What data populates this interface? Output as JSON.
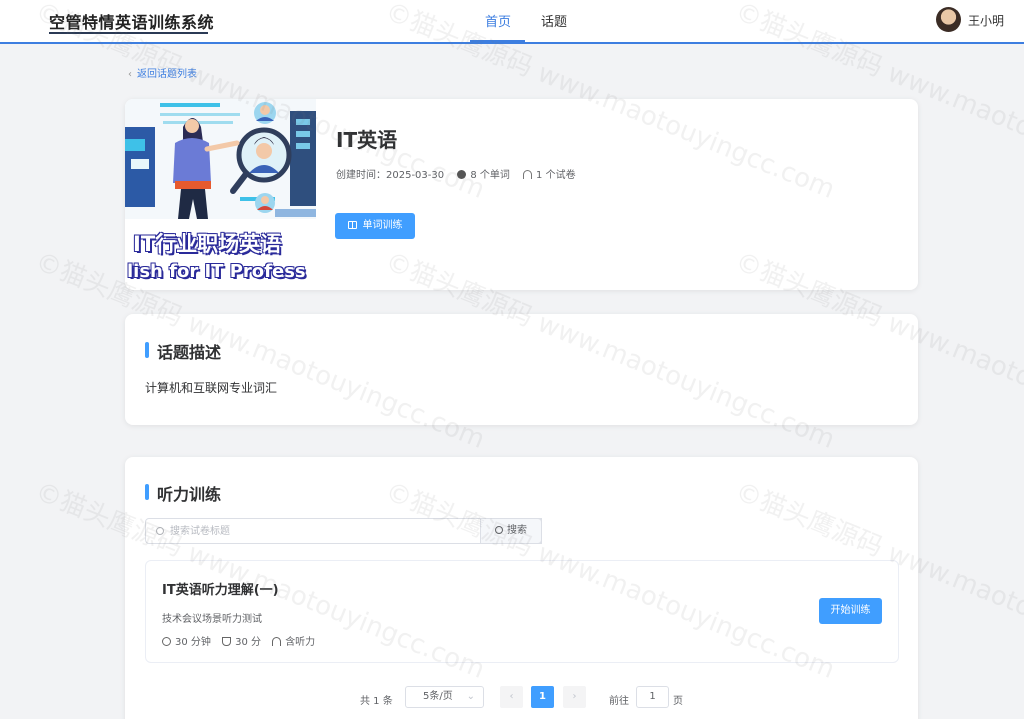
{
  "header": {
    "logo": "空管特情英语训练系统",
    "nav": [
      {
        "label": "首页"
      },
      {
        "label": "话题"
      }
    ],
    "user": {
      "name": "王小明"
    }
  },
  "back_link": "返回话题列表",
  "topic": {
    "cover_text_line1": "IT行业职场英语",
    "cover_text_line2": "lish for IT Profess",
    "title": "IT英语",
    "created_label": "创建时间：2025-03-30",
    "word_count": "8 个单词",
    "paper_count": "1 个试卷",
    "word_train_button": "单词训练"
  },
  "description": {
    "heading": "话题描述",
    "text": "计算机和互联网专业词汇"
  },
  "listening": {
    "heading": "听力训练",
    "search_placeholder": "搜索试卷标题",
    "search_button": "搜索",
    "papers": [
      {
        "title": "IT英语听力理解(一)",
        "subtitle": "技术会议场景听力测试",
        "duration": "30 分钟",
        "score": "30 分",
        "audio": "含听力",
        "start_button": "开始训练"
      }
    ],
    "pagination": {
      "total": "共 1 条",
      "page_size": "5条/页",
      "current_page": "1",
      "goto_label": "前往",
      "goto_value": "1",
      "page_suffix": "页"
    }
  },
  "watermark": "©猫头鹰源码 www.maotouyingcc.com",
  "colors": {
    "accent": "#409eff",
    "nav_active": "#3d7ee0"
  }
}
